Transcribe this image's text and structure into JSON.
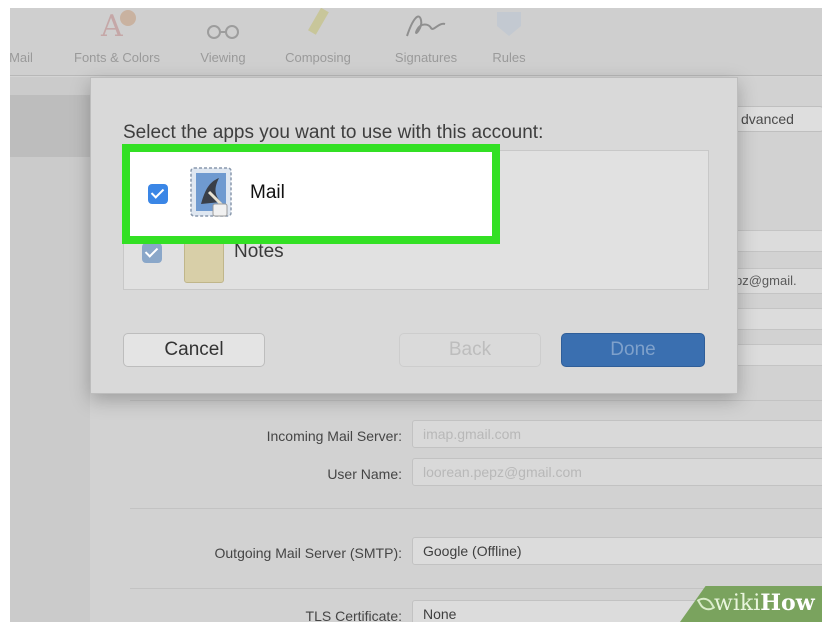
{
  "toolbar": {
    "items": [
      {
        "label": "Mail",
        "icon": "mail-icon"
      },
      {
        "label": "Fonts & Colors",
        "icon": "fonts-colors-icon"
      },
      {
        "label": "Viewing",
        "icon": "viewing-glasses-icon"
      },
      {
        "label": "Composing",
        "icon": "composing-pencil-icon"
      },
      {
        "label": "Signatures",
        "icon": "signature-icon"
      },
      {
        "label": "Rules",
        "icon": "rules-icon"
      }
    ]
  },
  "background": {
    "advanced_tab": "dvanced",
    "email_partial": "pz@gmail.",
    "incoming_server_label": "Incoming Mail Server:",
    "incoming_server_value": "imap.gmail.com",
    "user_name_label": "User Name:",
    "user_name_value": "loorean.pepz@gmail.com",
    "smtp_label": "Outgoing Mail Server (SMTP):",
    "smtp_value": "Google (Offline)",
    "tls_label": "TLS Certificate:",
    "tls_value": "None"
  },
  "sheet": {
    "title": "Select the apps you want to use with this account:",
    "apps": [
      {
        "label": "Mail",
        "checked": true,
        "icon": "mail-stamp-icon"
      },
      {
        "label": "Notes",
        "checked": true,
        "icon": "notes-icon"
      }
    ],
    "cancel_label": "Cancel",
    "back_label": "Back",
    "done_label": "Done"
  },
  "colors": {
    "highlight": "#33e024",
    "checkbox": "#3a86e6",
    "done_button": "#3a6fb0",
    "watermark": "#7aa35e"
  },
  "watermark": {
    "wiki": "wiki",
    "how": "How"
  }
}
